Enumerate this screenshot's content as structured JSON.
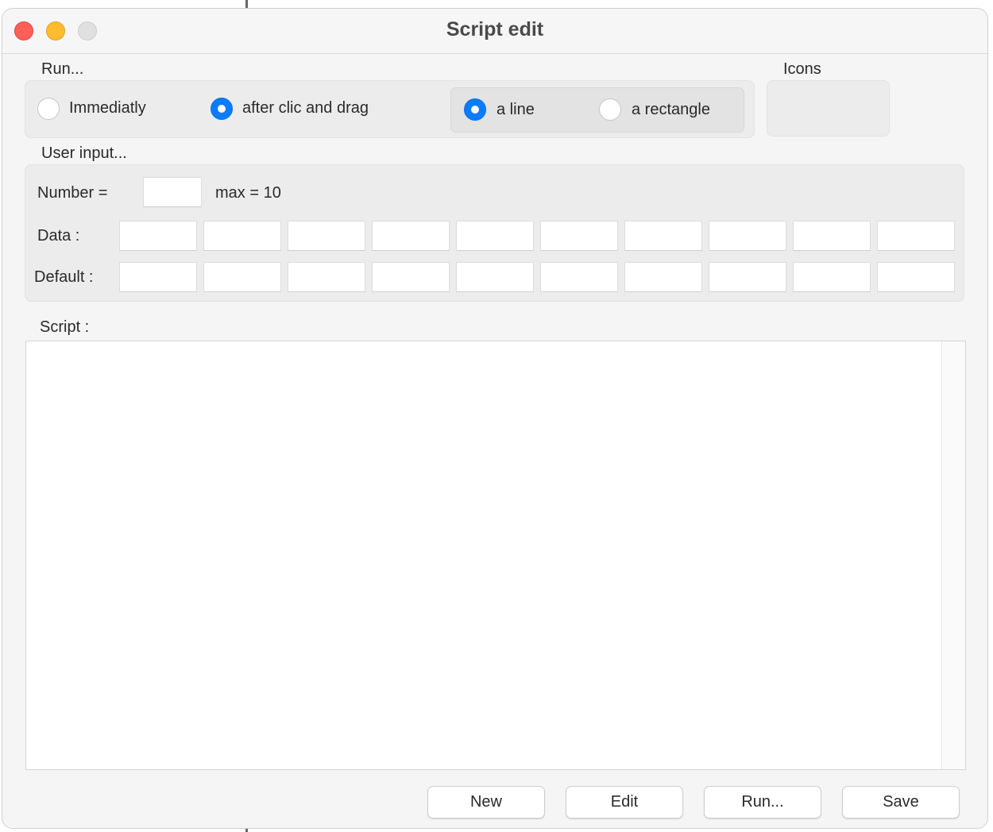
{
  "window": {
    "title": "Script edit"
  },
  "run_section": {
    "label": "Run...",
    "options": [
      {
        "label": "Immediatly",
        "selected": false
      },
      {
        "label": "after clic and drag",
        "selected": true
      }
    ],
    "drag_options": [
      {
        "label": "a line",
        "selected": true
      },
      {
        "label": "a rectangle",
        "selected": false
      }
    ]
  },
  "icons_section": {
    "label": "Icons"
  },
  "user_input": {
    "label": "User input...",
    "number_label": "Number =",
    "number_value": "",
    "max_label": "max = 10",
    "data_label": "Data :",
    "default_label": "Default :",
    "data_values": [
      "",
      "",
      "",
      "",
      "",
      "",
      "",
      "",
      "",
      ""
    ],
    "default_values": [
      "",
      "",
      "",
      "",
      "",
      "",
      "",
      "",
      "",
      ""
    ]
  },
  "script": {
    "label": "Script :",
    "content": ""
  },
  "buttons": {
    "new": "New",
    "edit": "Edit",
    "run": "Run...",
    "save": "Save"
  },
  "colors": {
    "accent": "#0a7cff",
    "close": "#fe5f57",
    "minimize": "#febc2e",
    "zoom": "#e0e0e0"
  }
}
